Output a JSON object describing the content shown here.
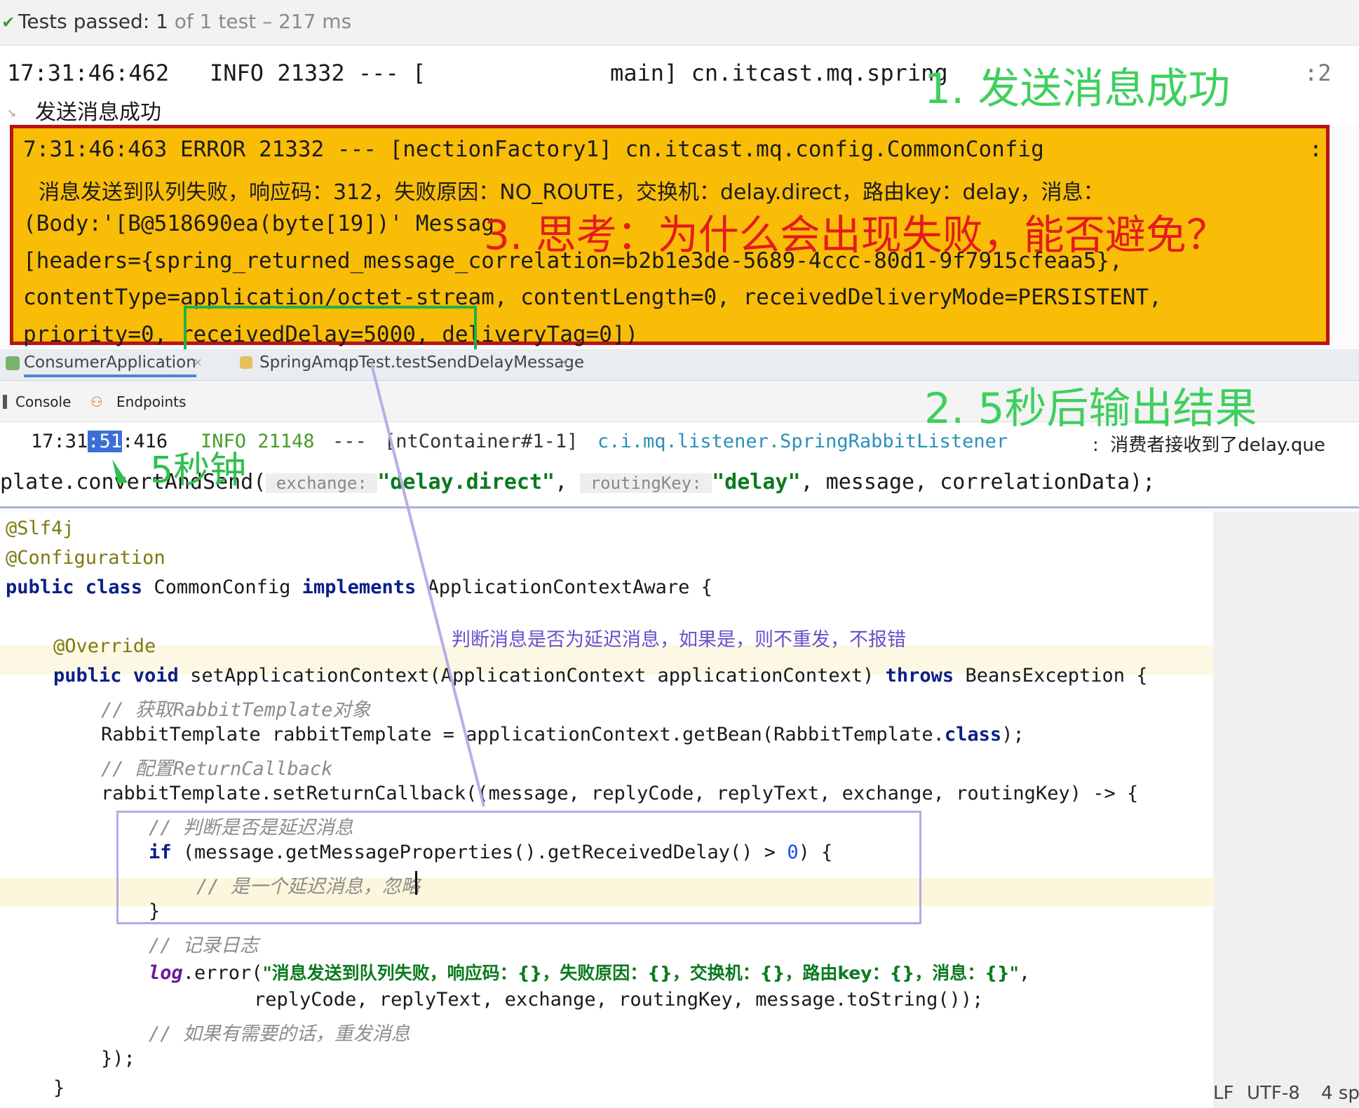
{
  "test_status": {
    "check": "✔",
    "prefix": "Tests passed: 1",
    "suffix": " of 1 test – 217 ms"
  },
  "log_top": {
    "line1_left": "17:31:46:462   INFO 21332 --- [",
    "line1_mid": "main] cn.itcast.mq.spring",
    "line1_end": ":2",
    "line2": "发送消息成功"
  },
  "error_box": {
    "line1": "7:31:46:463 ERROR 21332 --- [nectionFactory1] cn.itcast.mq.config.CommonConfig",
    "line1_end": ":",
    "line2": "消息发送到队列失败，响应码：312，失败原因：NO_ROUTE，交换机：delay.direct，路由key：delay，消息：",
    "line3": "(Body:'[B@518690ea(byte[19])' Messag",
    "line4": "[headers={spring_returned_message_correlation=b2b1e3de-5689-4ccc-80d1-9f7915cfeaa5},",
    "line5": "contentType=application/octet-stream, contentLength=0, receivedDeliveryMode=PERSISTENT,",
    "line6": "priority=0, receivedDelay=5000, deliveryTag=0])"
  },
  "tabs": [
    {
      "label": "ConsumerApplication"
    },
    {
      "label": "SpringAmqpTest.testSendDelayMessage"
    }
  ],
  "console_bar": {
    "console_label": "Console",
    "endpoints_label": "Endpoints"
  },
  "console_log": {
    "time_a": "17:31",
    "time_sel": ":51",
    "time_b": ":416",
    "level": "INFO 21148",
    "sep": "---",
    "thread": "[ntContainer#1-1]",
    "logger": "c.i.mq.listener.SpringRabbitListener",
    "msg": ":  消费者接收到了delay.que"
  },
  "code_strip": {
    "a": "plate.convertAndSend(",
    "hint1": " exchange: ",
    "s1": "\"delay.direct\"",
    "b": ", ",
    "hint2": " routingKey: ",
    "s2": "\"delay\"",
    "c": ", message, correlationData);"
  },
  "editor": {
    "l1": "@Slf4j",
    "l2": "@Configuration",
    "l3_kw": "public class",
    "l3_a": " CommonConfig ",
    "l3_kw2": "implements",
    "l3_b": " ApplicationContextAware {",
    "l4": "@Override",
    "l5_kw": "public void",
    "l5_a": " setApplicationContext(ApplicationContext applicationContext) ",
    "l5_kw2": "throws",
    "l5_b": " BeansException {",
    "l6": "// 获取RabbitTemplate对象",
    "l7_a": "RabbitTemplate rabbitTemplate = applicationContext.getBean(RabbitTemplate.",
    "l7_kw": "class",
    "l7_b": ");",
    "l8": "// 配置ReturnCallback",
    "l9": "rabbitTemplate.setReturnCallback((message, replyCode, replyText, exchange, routingKey) -> {",
    "l10": "// 判断是否是延迟消息",
    "l11_kw": "if",
    "l11_a": " (message.getMessageProperties().getReceivedDelay() > ",
    "l11_num": "0",
    "l11_b": ") {",
    "l12": "// 是一个延迟消息，忽略",
    "l13": "}",
    "l14": "// 记录日志",
    "l15_fld": "log",
    "l15_a": ".error(",
    "l15_str": "\"消息发送到队列失败，响应码：{}，失败原因：{}，交换机：{}，路由key：{}，消息：{}\"",
    "l15_b": ",",
    "l16": "replyCode, replyText, exchange, routingKey, message.toString());",
    "l17": "// 如果有需要的话，重发消息",
    "l18": "});",
    "l19": "}"
  },
  "annotations": {
    "a1": "1. 发送消息成功",
    "a2": "2. 5秒后输出结果",
    "a3": "3. 思考：为什么会出现失败，能否避免？",
    "a4": "5秒钟",
    "a5": "判断消息是否为延迟消息，如果是，则不重发，不报错"
  },
  "status_bottom": {
    "lf": "LF",
    "enc": "UTF-8",
    "indent": "4 sp"
  },
  "colors": {
    "error_bg": "#f9bd08",
    "error_border": "#b81414",
    "annotation_green": "#3fcf5e",
    "annotation_red": "#e31b1b",
    "annotation_purple": "#6b4fc9"
  }
}
